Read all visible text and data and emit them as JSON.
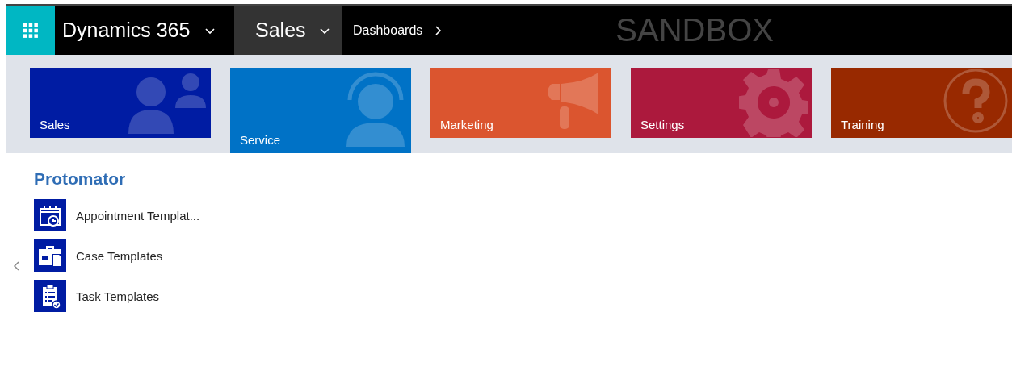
{
  "nav": {
    "app_name": "Dynamics 365",
    "area": "Sales",
    "breadcrumb": "Dashboards",
    "environment": "SANDBOX"
  },
  "tiles": [
    {
      "label": "Sales",
      "kind": "people",
      "color": "#001ca3",
      "selected": false
    },
    {
      "label": "Service",
      "kind": "headset",
      "color": "#0072c6",
      "selected": true
    },
    {
      "label": "Marketing",
      "kind": "megaphone",
      "color": "#db552f",
      "selected": false
    },
    {
      "label": "Settings",
      "kind": "gear",
      "color": "#ac193d",
      "selected": false
    },
    {
      "label": "Training",
      "kind": "help",
      "color": "#982900",
      "selected": false
    }
  ],
  "section": {
    "title": "Protomator",
    "items": [
      {
        "label": "Appointment Templat...",
        "kind": "calendar"
      },
      {
        "label": "Case Templates",
        "kind": "briefcase"
      },
      {
        "label": "Task Templates",
        "kind": "clipboard"
      }
    ]
  }
}
